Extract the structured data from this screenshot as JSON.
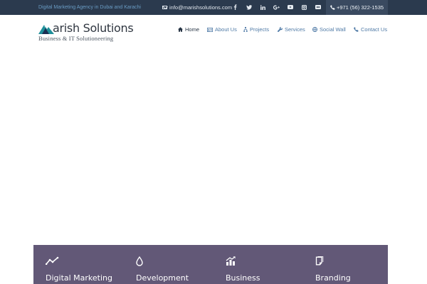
{
  "topbar": {
    "tagline": "Digital Marketing Agency in Dubai and Karachi",
    "email": "info@marishsolutions.com",
    "social_icons": [
      "facebook-icon",
      "twitter-icon",
      "linkedin-icon",
      "google-plus-icon",
      "youtube-icon",
      "instagram-icon",
      "flickr-icon"
    ],
    "phone": "+971 (56) 322-1535"
  },
  "logo": {
    "title": "arish Solutions",
    "subtitle": "Business & IT Solutioneering"
  },
  "nav": {
    "items": [
      {
        "label": "Home",
        "icon": "home-icon",
        "active": true
      },
      {
        "label": "About Us",
        "icon": "id-card-icon",
        "active": false
      },
      {
        "label": "Projects",
        "icon": "sitemap-icon",
        "active": false
      },
      {
        "label": "Services",
        "icon": "wrench-icon",
        "active": false
      },
      {
        "label": "Social Wall",
        "icon": "globe-icon",
        "active": false
      },
      {
        "label": "Contact Us",
        "icon": "phone-icon",
        "active": false
      }
    ]
  },
  "services": [
    {
      "label": "Digital Marketing",
      "icon": "trend-line-icon"
    },
    {
      "label": "Development",
      "icon": "droplet-icon"
    },
    {
      "label": "Business",
      "icon": "growth-chart-icon"
    },
    {
      "label": "Branding",
      "icon": "paper-icon"
    }
  ],
  "colors": {
    "topbar_bg": "#2b3a4e",
    "tagline": "#6a9cc4",
    "nav_link": "#4f7aa6",
    "services_bg": "#625877"
  }
}
